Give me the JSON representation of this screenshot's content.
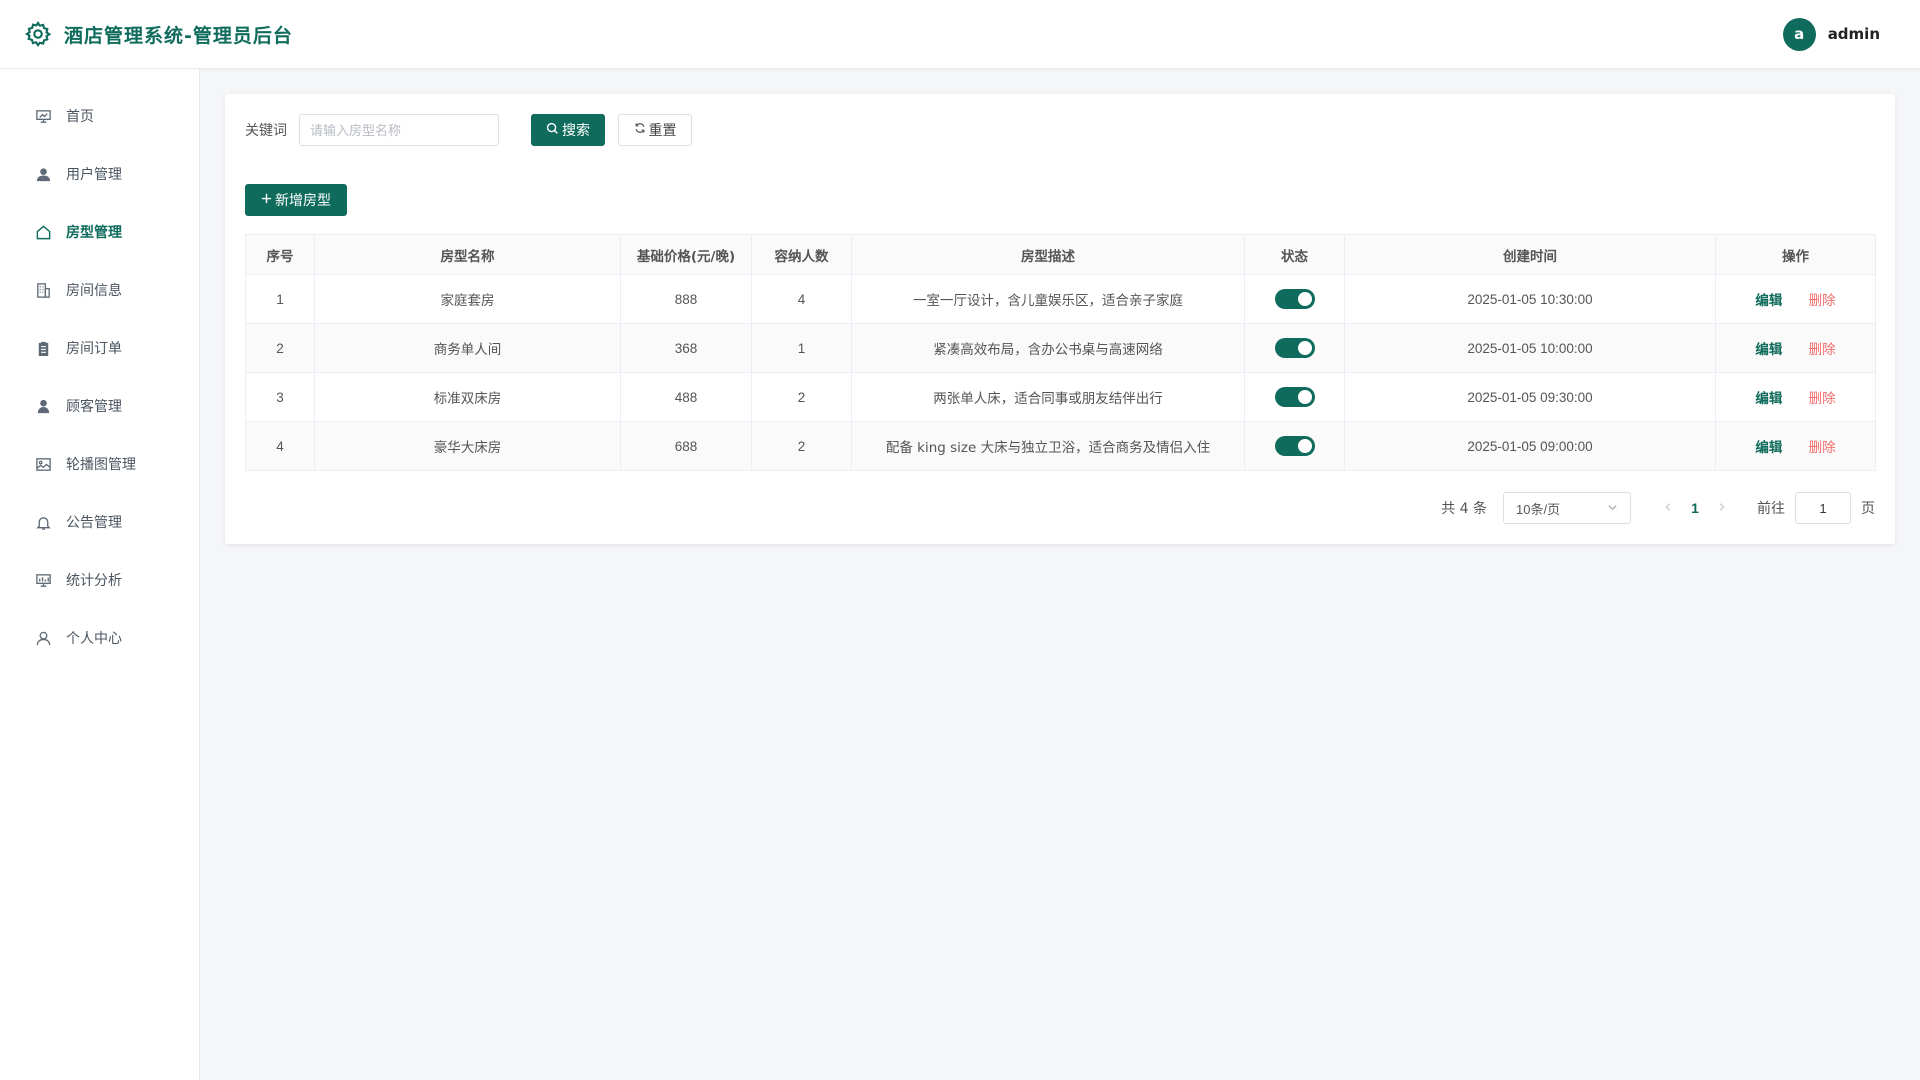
{
  "app": {
    "title": "酒店管理系统-管理员后台"
  },
  "user": {
    "avatar_letter": "a",
    "name": "admin"
  },
  "colors": {
    "primary": "#0f6b5c",
    "danger": "#f56c6c"
  },
  "sidebar": {
    "items": [
      {
        "label": "首页",
        "icon": "dashboard-icon",
        "active": false
      },
      {
        "label": "用户管理",
        "icon": "user-icon",
        "active": false
      },
      {
        "label": "房型管理",
        "icon": "house-icon",
        "active": true
      },
      {
        "label": "房间信息",
        "icon": "building-icon",
        "active": false
      },
      {
        "label": "房间订单",
        "icon": "clipboard-icon",
        "active": false
      },
      {
        "label": "顾客管理",
        "icon": "customer-icon",
        "active": false
      },
      {
        "label": "轮播图管理",
        "icon": "image-icon",
        "active": false
      },
      {
        "label": "公告管理",
        "icon": "bell-icon",
        "active": false
      },
      {
        "label": "统计分析",
        "icon": "chart-icon",
        "active": false
      },
      {
        "label": "个人中心",
        "icon": "profile-icon",
        "active": false
      }
    ]
  },
  "search": {
    "label": "关键词",
    "placeholder": "请输入房型名称",
    "value": "",
    "search_button": "搜索",
    "reset_button": "重置"
  },
  "toolbar": {
    "add_button": "新增房型"
  },
  "table": {
    "columns": [
      "序号",
      "房型名称",
      "基础价格(元/晚)",
      "容纳人数",
      "房型描述",
      "状态",
      "创建时间",
      "操作"
    ],
    "rows": [
      {
        "index": "1",
        "name": "家庭套房",
        "price": "888",
        "capacity": "4",
        "description": "一室一厅设计，含儿童娱乐区，适合亲子家庭",
        "status_on": true,
        "created": "2025-01-05 10:30:00"
      },
      {
        "index": "2",
        "name": "商务单人间",
        "price": "368",
        "capacity": "1",
        "description": "紧凑高效布局，含办公书桌与高速网络",
        "status_on": true,
        "created": "2025-01-05 10:00:00"
      },
      {
        "index": "3",
        "name": "标准双床房",
        "price": "488",
        "capacity": "2",
        "description": "两张单人床，适合同事或朋友结伴出行",
        "status_on": true,
        "created": "2025-01-05 09:30:00"
      },
      {
        "index": "4",
        "name": "豪华大床房",
        "price": "688",
        "capacity": "2",
        "description": "配备 king size 大床与独立卫浴，适合商务及情侣入住",
        "status_on": true,
        "created": "2025-01-05 09:00:00"
      }
    ],
    "actions": {
      "edit": "编辑",
      "delete": "删除"
    }
  },
  "pagination": {
    "total_text": "共 4 条",
    "page_size": "10条/页",
    "current_page": "1",
    "goto_label": "前往",
    "goto_value": "1",
    "page_suffix": "页"
  }
}
